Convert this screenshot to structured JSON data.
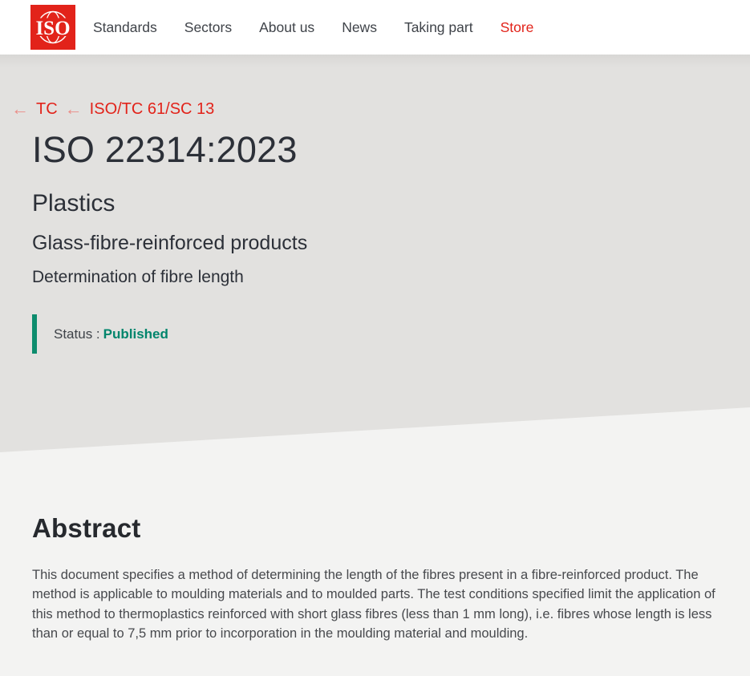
{
  "brand": {
    "logo_text": "ISO",
    "logo_color": "#e2231a"
  },
  "nav": {
    "items": [
      {
        "label": "Standards"
      },
      {
        "label": "Sectors"
      },
      {
        "label": "About us"
      },
      {
        "label": "News"
      },
      {
        "label": "Taking part"
      },
      {
        "label": "Store"
      }
    ]
  },
  "hero": {
    "breadcrumb": [
      {
        "label": "TC"
      },
      {
        "label": "ISO/TC 61/SC 13"
      }
    ],
    "title": "ISO 22314:2023",
    "subtitle1": "Plastics",
    "subtitle2": "Glass-fibre-reinforced products",
    "subtitle3": "Determination of fibre length",
    "status_label": "Status :",
    "status_value": "Published",
    "status_color": "#00856c",
    "accent_red": "#e2231a",
    "hero_background": "#e2e1df"
  },
  "abstract": {
    "heading": "Abstract",
    "text": "This document specifies a method of determining the length of the fibres present in a fibre-reinforced product. The method is applicable to moulding materials and to moulded parts. The test conditions specified limit the application of this method to thermoplastics reinforced with short glass fibres (less than 1 mm long), i.e. fibres whose length is less than or equal to 7,5 mm prior to incorporation in the moulding material and moulding."
  }
}
